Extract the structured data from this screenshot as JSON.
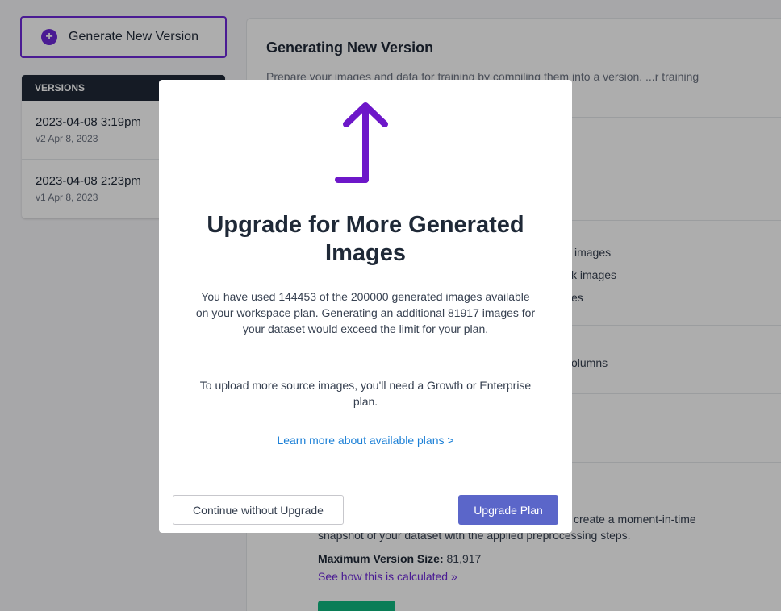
{
  "sidebar": {
    "generate_button_label": "Generate New Version",
    "versions_header": "VERSIONS",
    "versions": [
      {
        "title": "2023-04-08 3:19pm",
        "subtitle": "v2 Apr 8, 2023"
      },
      {
        "title": "2023-04-08 2:23pm",
        "subtitle": "v1 Apr 8, 2023"
      }
    ]
  },
  "main": {
    "title": "Generating New Version",
    "description": "Prepare your images and data for training by compiling them into a version. ...r training results.",
    "partial_rows": [
      "images",
      "k images",
      "es",
      "olumns"
    ],
    "generate_desc_line1": "create a moment-in-time",
    "generate_desc_line2": "snapshot of your dataset with the applied preprocessing steps.",
    "max_size_label": "Maximum Version Size:",
    "max_size_value": "81,917",
    "see_how_link": "See how this is calculated »"
  },
  "modal": {
    "icon": "upgrade-arrow-icon",
    "title": "Upgrade for More Generated Images",
    "body": "You have used 144453 of the 200000 generated images available on your workspace plan. Generating an additional 81917 images for your dataset would exceed the limit for your plan.",
    "body2": "To upload more source images, you'll need a Growth or Enterprise plan.",
    "link": "Learn more about available plans >",
    "continue_button": "Continue without Upgrade",
    "upgrade_button": "Upgrade Plan"
  },
  "colors": {
    "accent": "#6d28d9",
    "upgrade_button": "#5b66c9",
    "link": "#1a7fd6"
  }
}
